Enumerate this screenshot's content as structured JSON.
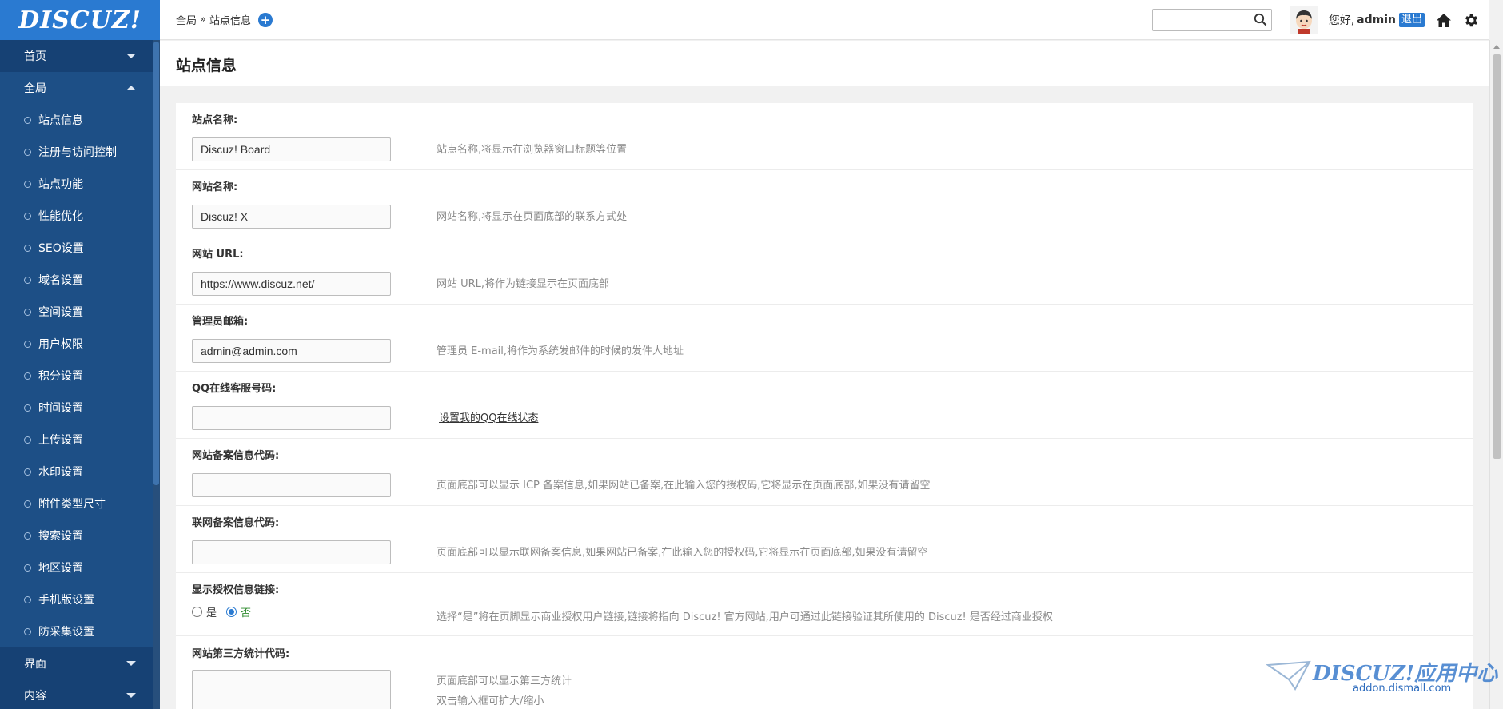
{
  "logo": {
    "text": "DISCUZ!"
  },
  "sidebar": {
    "groups": [
      {
        "label": "首页",
        "state": "collapsed"
      },
      {
        "label": "全局",
        "state": "expanded"
      }
    ],
    "items": [
      {
        "label": "站点信息"
      },
      {
        "label": "注册与访问控制"
      },
      {
        "label": "站点功能"
      },
      {
        "label": "性能优化"
      },
      {
        "label": "SEO设置"
      },
      {
        "label": "域名设置"
      },
      {
        "label": "空间设置"
      },
      {
        "label": "用户权限"
      },
      {
        "label": "积分设置"
      },
      {
        "label": "时间设置"
      },
      {
        "label": "上传设置"
      },
      {
        "label": "水印设置"
      },
      {
        "label": "附件类型尺寸"
      },
      {
        "label": "搜索设置"
      },
      {
        "label": "地区设置"
      },
      {
        "label": "手机版设置"
      },
      {
        "label": "防采集设置"
      }
    ],
    "bottom_groups": [
      {
        "label": "界面"
      },
      {
        "label": "内容"
      }
    ]
  },
  "header": {
    "breadcrumb": {
      "root": "全局",
      "separator": "»",
      "current": "站点信息"
    },
    "search": {
      "value": "",
      "placeholder": ""
    },
    "greeting": "您好,",
    "username": "admin",
    "logout_label": "退出"
  },
  "page": {
    "title": "站点信息"
  },
  "form": {
    "rows": [
      {
        "label": "站点名称:",
        "type": "text",
        "value": "Discuz! Board",
        "help": "站点名称,将显示在浏览器窗口标题等位置"
      },
      {
        "label": "网站名称:",
        "type": "text",
        "value": "Discuz! X",
        "help": "网站名称,将显示在页面底部的联系方式处"
      },
      {
        "label": "网站 URL:",
        "type": "text",
        "value": "https://www.discuz.net/",
        "help": "网站 URL,将作为链接显示在页面底部"
      },
      {
        "label": "管理员邮箱:",
        "type": "text",
        "value": "admin@admin.com",
        "help": "管理员 E-mail,将作为系统发邮件的时候的发件人地址"
      },
      {
        "label": "QQ在线客服号码:",
        "type": "text",
        "value": "",
        "link": "设置我的QQ在线状态"
      },
      {
        "label": "网站备案信息代码:",
        "type": "text",
        "value": "",
        "help": "页面底部可以显示 ICP 备案信息,如果网站已备案,在此输入您的授权码,它将显示在页面底部,如果没有请留空"
      },
      {
        "label": "联网备案信息代码:",
        "type": "text",
        "value": "",
        "help": "页面底部可以显示联网备案信息,如果网站已备案,在此输入您的授权码,它将显示在页面底部,如果没有请留空"
      },
      {
        "label": "显示授权信息链接:",
        "type": "radio",
        "options": [
          "是",
          "否"
        ],
        "selected": "否",
        "help": "选择“是”将在页脚显示商业授权用户链接,链接将指向 Discuz! 官方网站,用户可通过此链接验证其所使用的 Discuz! 是否经过商业授权"
      },
      {
        "label": "网站第三方统计代码:",
        "type": "textarea",
        "value": "",
        "help": "页面底部可以显示第三方统计",
        "help2": "双击输入框可扩大/缩小"
      }
    ]
  },
  "watermark": {
    "brand": "DISCUZ!应用中心",
    "sub": "addon.dismall.com"
  },
  "colors": {
    "sidebar": "#1d4f86",
    "sidebar_dark": "#164174",
    "logo_bg": "#2a7ad1",
    "accent": "#2a7ad1",
    "selected_radio_text": "#2e8b2e"
  }
}
